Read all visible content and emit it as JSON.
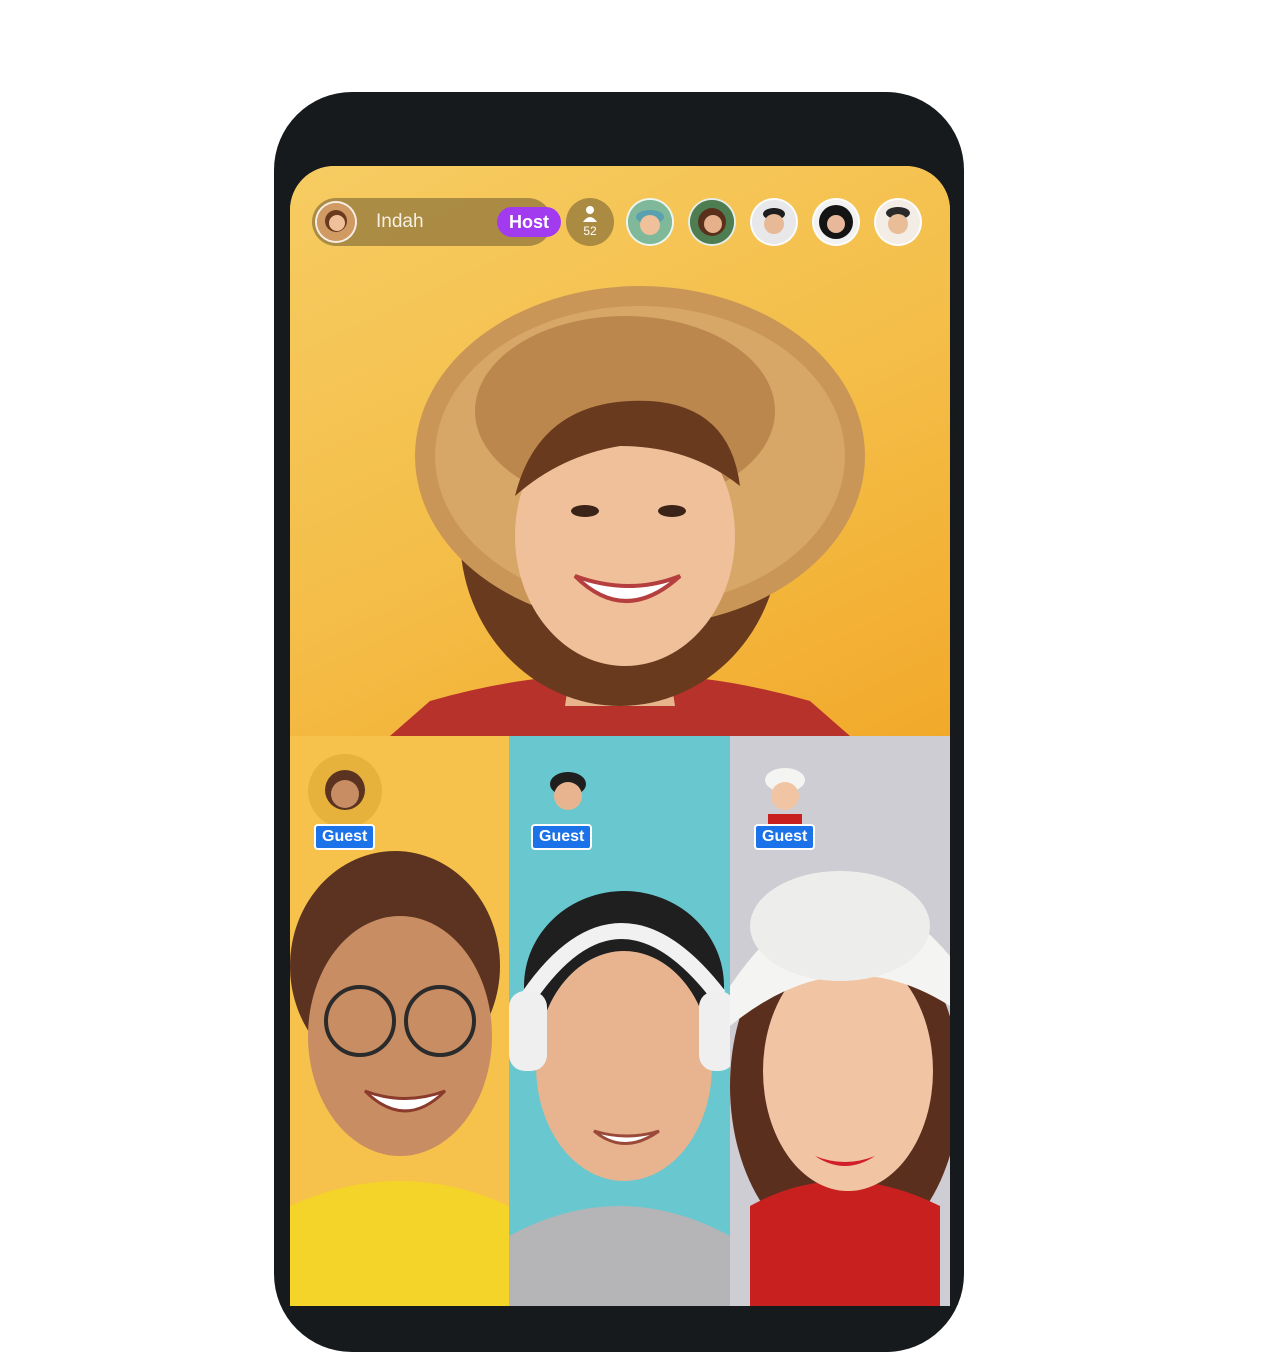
{
  "stream": {
    "host": {
      "name": "Indah",
      "badge": "Host",
      "avatar_icon": "host-avatar"
    },
    "viewer_count": "52",
    "viewer_icon": "person-icon",
    "viewers": [
      {
        "name": "viewer-1"
      },
      {
        "name": "viewer-2"
      },
      {
        "name": "viewer-3"
      },
      {
        "name": "viewer-4"
      },
      {
        "name": "viewer-5"
      }
    ],
    "guests": [
      {
        "badge": "Guest",
        "bg": "#f6c24b"
      },
      {
        "badge": "Guest",
        "bg": "#69c7cf"
      },
      {
        "badge": "Guest",
        "bg": "#cdcdd3"
      }
    ]
  },
  "colors": {
    "host_badge": "#a23bf0",
    "guest_badge": "#1c72e8",
    "host_bg": "#f4bd47"
  }
}
